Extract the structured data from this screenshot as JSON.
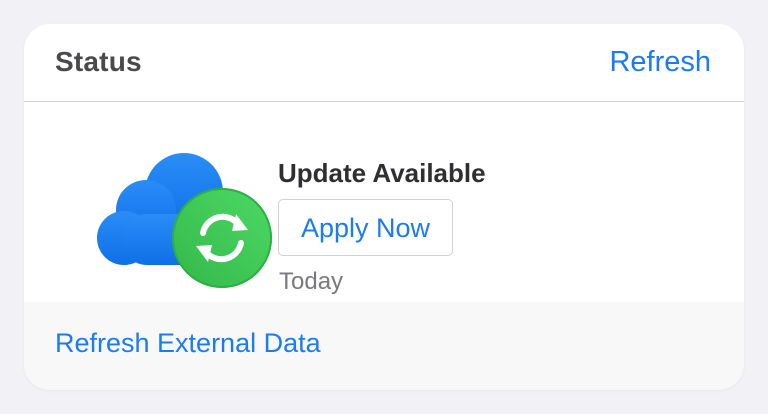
{
  "header": {
    "title": "Status",
    "refresh_label": "Refresh"
  },
  "update": {
    "title": "Update Available",
    "apply_label": "Apply Now",
    "date": "Today",
    "icon": "cloud-sync-icon"
  },
  "footer": {
    "link_label": "Refresh External Data"
  },
  "colors": {
    "accent": "#1a7cf0",
    "cloud": "#1e7ef5",
    "sync_badge": "#3fc556",
    "background": "#f2f2f6"
  }
}
